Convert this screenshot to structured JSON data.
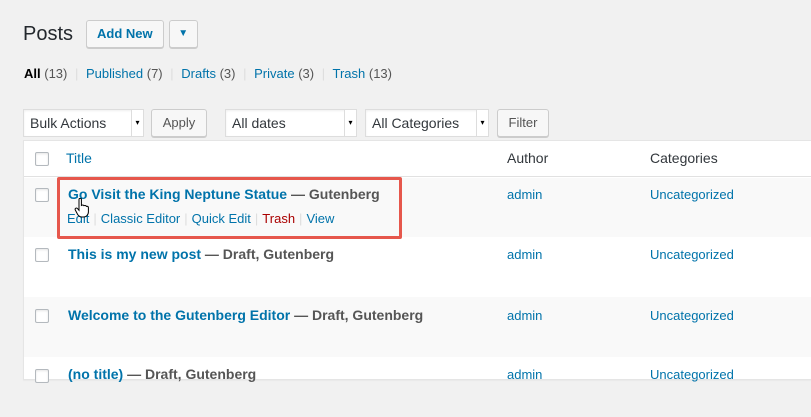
{
  "header": {
    "title": "Posts",
    "add_new_label": "Add New",
    "dropdown_glyph": "▼"
  },
  "filters": {
    "all_label": "All",
    "all_count": "(13)",
    "published_label": "Published",
    "published_count": "(7)",
    "drafts_label": "Drafts",
    "drafts_count": "(3)",
    "private_label": "Private",
    "private_count": "(3)",
    "trash_label": "Trash",
    "trash_count": "(13)",
    "separator": "|"
  },
  "toolbar": {
    "bulk_actions": "Bulk Actions",
    "apply_label": "Apply",
    "dates": "All dates",
    "categories": "All Categories",
    "filter_label": "Filter",
    "select_arrow": "▾"
  },
  "table": {
    "headers": {
      "title": "Title",
      "author": "Author",
      "categories": "Categories"
    },
    "rows": [
      {
        "title": "Go Visit the King Neptune Statue",
        "state": " — Gutenberg",
        "author": "admin",
        "category": "Uncategorized",
        "actions": {
          "edit": "Edit",
          "classic": "Classic Editor",
          "quick": "Quick Edit",
          "trash": "Trash",
          "view": "View",
          "separator": "|"
        }
      },
      {
        "title": "This is my new post",
        "state": " — Draft, Gutenberg",
        "author": "admin",
        "category": "Uncategorized"
      },
      {
        "title": "Welcome to the Gutenberg Editor",
        "state": " — Draft, Gutenberg",
        "author": "admin",
        "category": "Uncategorized"
      },
      {
        "title": "(no title)",
        "state": " — Draft, Gutenberg",
        "author": "admin",
        "category": "Uncategorized"
      }
    ]
  },
  "colors": {
    "link": "#0073aa",
    "trash": "#aa0000",
    "highlight": "#e6574c",
    "background": "#f1f1f1"
  },
  "icons": {
    "cursor": "hand-pointer-icon"
  }
}
